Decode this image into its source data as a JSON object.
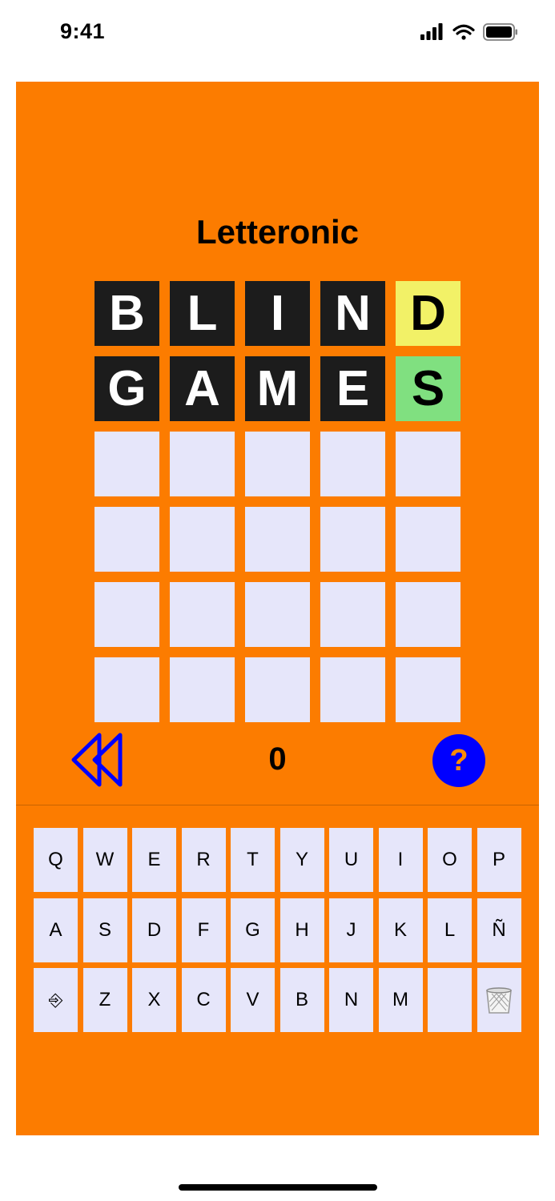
{
  "status": {
    "time": "9:41"
  },
  "app": {
    "title": "Letteronic",
    "score": "0",
    "help_label": "?"
  },
  "board": {
    "rows": [
      [
        {
          "letter": "B",
          "state": "absent"
        },
        {
          "letter": "L",
          "state": "absent"
        },
        {
          "letter": "I",
          "state": "absent"
        },
        {
          "letter": "N",
          "state": "absent"
        },
        {
          "letter": "D",
          "state": "present"
        }
      ],
      [
        {
          "letter": "G",
          "state": "absent"
        },
        {
          "letter": "A",
          "state": "absent"
        },
        {
          "letter": "M",
          "state": "absent"
        },
        {
          "letter": "E",
          "state": "absent"
        },
        {
          "letter": "S",
          "state": "correct"
        }
      ],
      [
        {
          "letter": "",
          "state": "empty"
        },
        {
          "letter": "",
          "state": "empty"
        },
        {
          "letter": "",
          "state": "empty"
        },
        {
          "letter": "",
          "state": "empty"
        },
        {
          "letter": "",
          "state": "empty"
        }
      ],
      [
        {
          "letter": "",
          "state": "empty"
        },
        {
          "letter": "",
          "state": "empty"
        },
        {
          "letter": "",
          "state": "empty"
        },
        {
          "letter": "",
          "state": "empty"
        },
        {
          "letter": "",
          "state": "empty"
        }
      ],
      [
        {
          "letter": "",
          "state": "empty"
        },
        {
          "letter": "",
          "state": "empty"
        },
        {
          "letter": "",
          "state": "empty"
        },
        {
          "letter": "",
          "state": "empty"
        },
        {
          "letter": "",
          "state": "empty"
        }
      ],
      [
        {
          "letter": "",
          "state": "empty"
        },
        {
          "letter": "",
          "state": "empty"
        },
        {
          "letter": "",
          "state": "empty"
        },
        {
          "letter": "",
          "state": "empty"
        },
        {
          "letter": "",
          "state": "empty"
        }
      ]
    ]
  },
  "keyboard": {
    "rows": [
      [
        "Q",
        "W",
        "E",
        "R",
        "T",
        "Y",
        "U",
        "I",
        "O",
        "P"
      ],
      [
        "A",
        "S",
        "D",
        "F",
        "G",
        "H",
        "J",
        "K",
        "L",
        "Ñ"
      ],
      [
        "⎆",
        "Z",
        "X",
        "C",
        "V",
        "B",
        "N",
        "M",
        "",
        ""
      ]
    ],
    "icons": {
      "enter": "enter-arrow-icon",
      "delete": "trash-icon"
    }
  },
  "colors": {
    "background": "#FC7C00",
    "absent": "#1C1C1C",
    "present": "#F2F167",
    "correct": "#80E080",
    "empty": "#E6E6FA",
    "accent": "#0000FF"
  },
  "icons": {
    "rewind": "rewind-icon",
    "help": "help-icon"
  }
}
